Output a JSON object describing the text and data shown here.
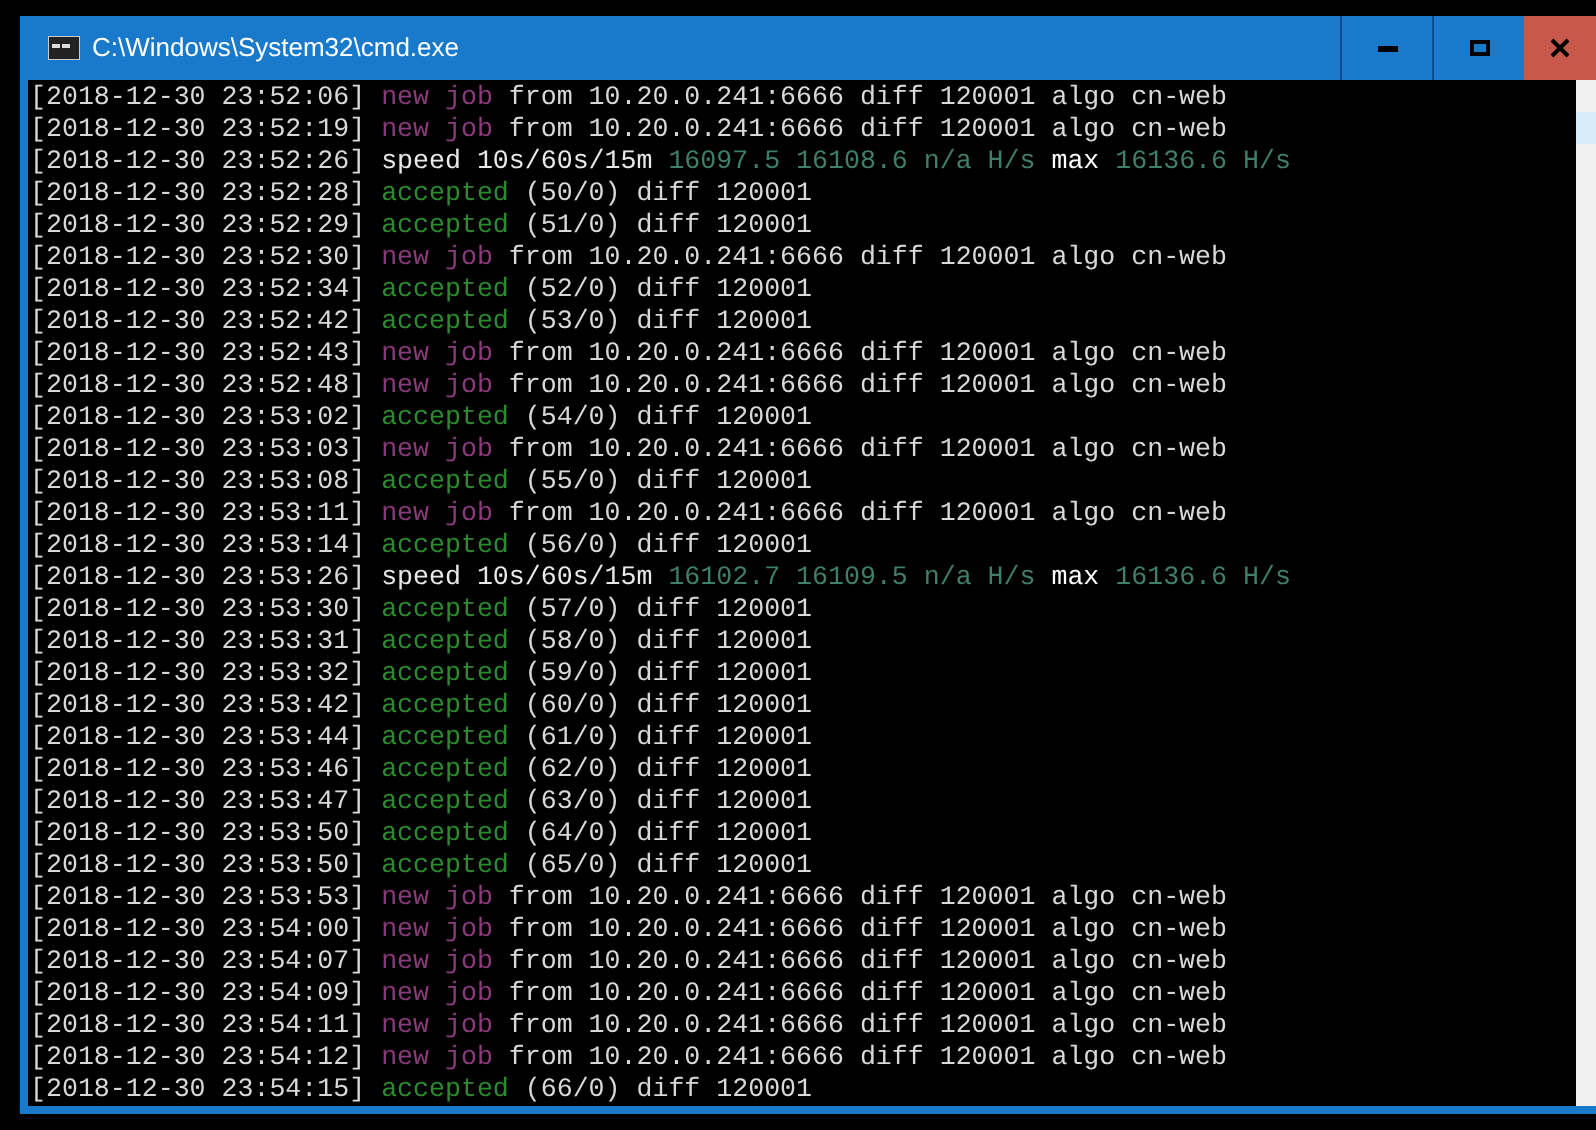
{
  "window": {
    "title": "C:\\Windows\\System32\\cmd.exe"
  },
  "lines": [
    {
      "kind": "job",
      "time": "[2018-12-30 23:52:06]",
      "tag": "new job",
      "rest": "from 10.20.0.241:6666 diff 120001 algo cn-web"
    },
    {
      "kind": "job",
      "time": "[2018-12-30 23:52:19]",
      "tag": "new job",
      "rest": "from 10.20.0.241:6666 diff 120001 algo cn-web"
    },
    {
      "kind": "speed",
      "time": "[2018-12-30 23:52:26]",
      "tag": "speed 10s/60s/15m",
      "values": "16097.5 16108.6 n/a H/s",
      "max_label": "max",
      "max": "16136.6 H/s"
    },
    {
      "kind": "accepted",
      "time": "[2018-12-30 23:52:28]",
      "tag": "accepted",
      "rest": "(50/0) diff 120001"
    },
    {
      "kind": "accepted",
      "time": "[2018-12-30 23:52:29]",
      "tag": "accepted",
      "rest": "(51/0) diff 120001"
    },
    {
      "kind": "job",
      "time": "[2018-12-30 23:52:30]",
      "tag": "new job",
      "rest": "from 10.20.0.241:6666 diff 120001 algo cn-web"
    },
    {
      "kind": "accepted",
      "time": "[2018-12-30 23:52:34]",
      "tag": "accepted",
      "rest": "(52/0) diff 120001"
    },
    {
      "kind": "accepted",
      "time": "[2018-12-30 23:52:42]",
      "tag": "accepted",
      "rest": "(53/0) diff 120001"
    },
    {
      "kind": "job",
      "time": "[2018-12-30 23:52:43]",
      "tag": "new job",
      "rest": "from 10.20.0.241:6666 diff 120001 algo cn-web"
    },
    {
      "kind": "job",
      "time": "[2018-12-30 23:52:48]",
      "tag": "new job",
      "rest": "from 10.20.0.241:6666 diff 120001 algo cn-web"
    },
    {
      "kind": "accepted",
      "time": "[2018-12-30 23:53:02]",
      "tag": "accepted",
      "rest": "(54/0) diff 120001"
    },
    {
      "kind": "job",
      "time": "[2018-12-30 23:53:03]",
      "tag": "new job",
      "rest": "from 10.20.0.241:6666 diff 120001 algo cn-web"
    },
    {
      "kind": "accepted",
      "time": "[2018-12-30 23:53:08]",
      "tag": "accepted",
      "rest": "(55/0) diff 120001"
    },
    {
      "kind": "job",
      "time": "[2018-12-30 23:53:11]",
      "tag": "new job",
      "rest": "from 10.20.0.241:6666 diff 120001 algo cn-web"
    },
    {
      "kind": "accepted",
      "time": "[2018-12-30 23:53:14]",
      "tag": "accepted",
      "rest": "(56/0) diff 120001"
    },
    {
      "kind": "speed",
      "time": "[2018-12-30 23:53:26]",
      "tag": "speed 10s/60s/15m",
      "values": "16102.7 16109.5 n/a H/s",
      "max_label": "max",
      "max": "16136.6 H/s"
    },
    {
      "kind": "accepted",
      "time": "[2018-12-30 23:53:30]",
      "tag": "accepted",
      "rest": "(57/0) diff 120001"
    },
    {
      "kind": "accepted",
      "time": "[2018-12-30 23:53:31]",
      "tag": "accepted",
      "rest": "(58/0) diff 120001"
    },
    {
      "kind": "accepted",
      "time": "[2018-12-30 23:53:32]",
      "tag": "accepted",
      "rest": "(59/0) diff 120001"
    },
    {
      "kind": "accepted",
      "time": "[2018-12-30 23:53:42]",
      "tag": "accepted",
      "rest": "(60/0) diff 120001"
    },
    {
      "kind": "accepted",
      "time": "[2018-12-30 23:53:44]",
      "tag": "accepted",
      "rest": "(61/0) diff 120001"
    },
    {
      "kind": "accepted",
      "time": "[2018-12-30 23:53:46]",
      "tag": "accepted",
      "rest": "(62/0) diff 120001"
    },
    {
      "kind": "accepted",
      "time": "[2018-12-30 23:53:47]",
      "tag": "accepted",
      "rest": "(63/0) diff 120001"
    },
    {
      "kind": "accepted",
      "time": "[2018-12-30 23:53:50]",
      "tag": "accepted",
      "rest": "(64/0) diff 120001"
    },
    {
      "kind": "accepted",
      "time": "[2018-12-30 23:53:50]",
      "tag": "accepted",
      "rest": "(65/0) diff 120001"
    },
    {
      "kind": "job",
      "time": "[2018-12-30 23:53:53]",
      "tag": "new job",
      "rest": "from 10.20.0.241:6666 diff 120001 algo cn-web"
    },
    {
      "kind": "job",
      "time": "[2018-12-30 23:54:00]",
      "tag": "new job",
      "rest": "from 10.20.0.241:6666 diff 120001 algo cn-web"
    },
    {
      "kind": "job",
      "time": "[2018-12-30 23:54:07]",
      "tag": "new job",
      "rest": "from 10.20.0.241:6666 diff 120001 algo cn-web"
    },
    {
      "kind": "job",
      "time": "[2018-12-30 23:54:09]",
      "tag": "new job",
      "rest": "from 10.20.0.241:6666 diff 120001 algo cn-web"
    },
    {
      "kind": "job",
      "time": "[2018-12-30 23:54:11]",
      "tag": "new job",
      "rest": "from 10.20.0.241:6666 diff 120001 algo cn-web"
    },
    {
      "kind": "job",
      "time": "[2018-12-30 23:54:12]",
      "tag": "new job",
      "rest": "from 10.20.0.241:6666 diff 120001 algo cn-web"
    },
    {
      "kind": "accepted",
      "time": "[2018-12-30 23:54:15]",
      "tag": "accepted",
      "rest": "(66/0) diff 120001"
    }
  ]
}
